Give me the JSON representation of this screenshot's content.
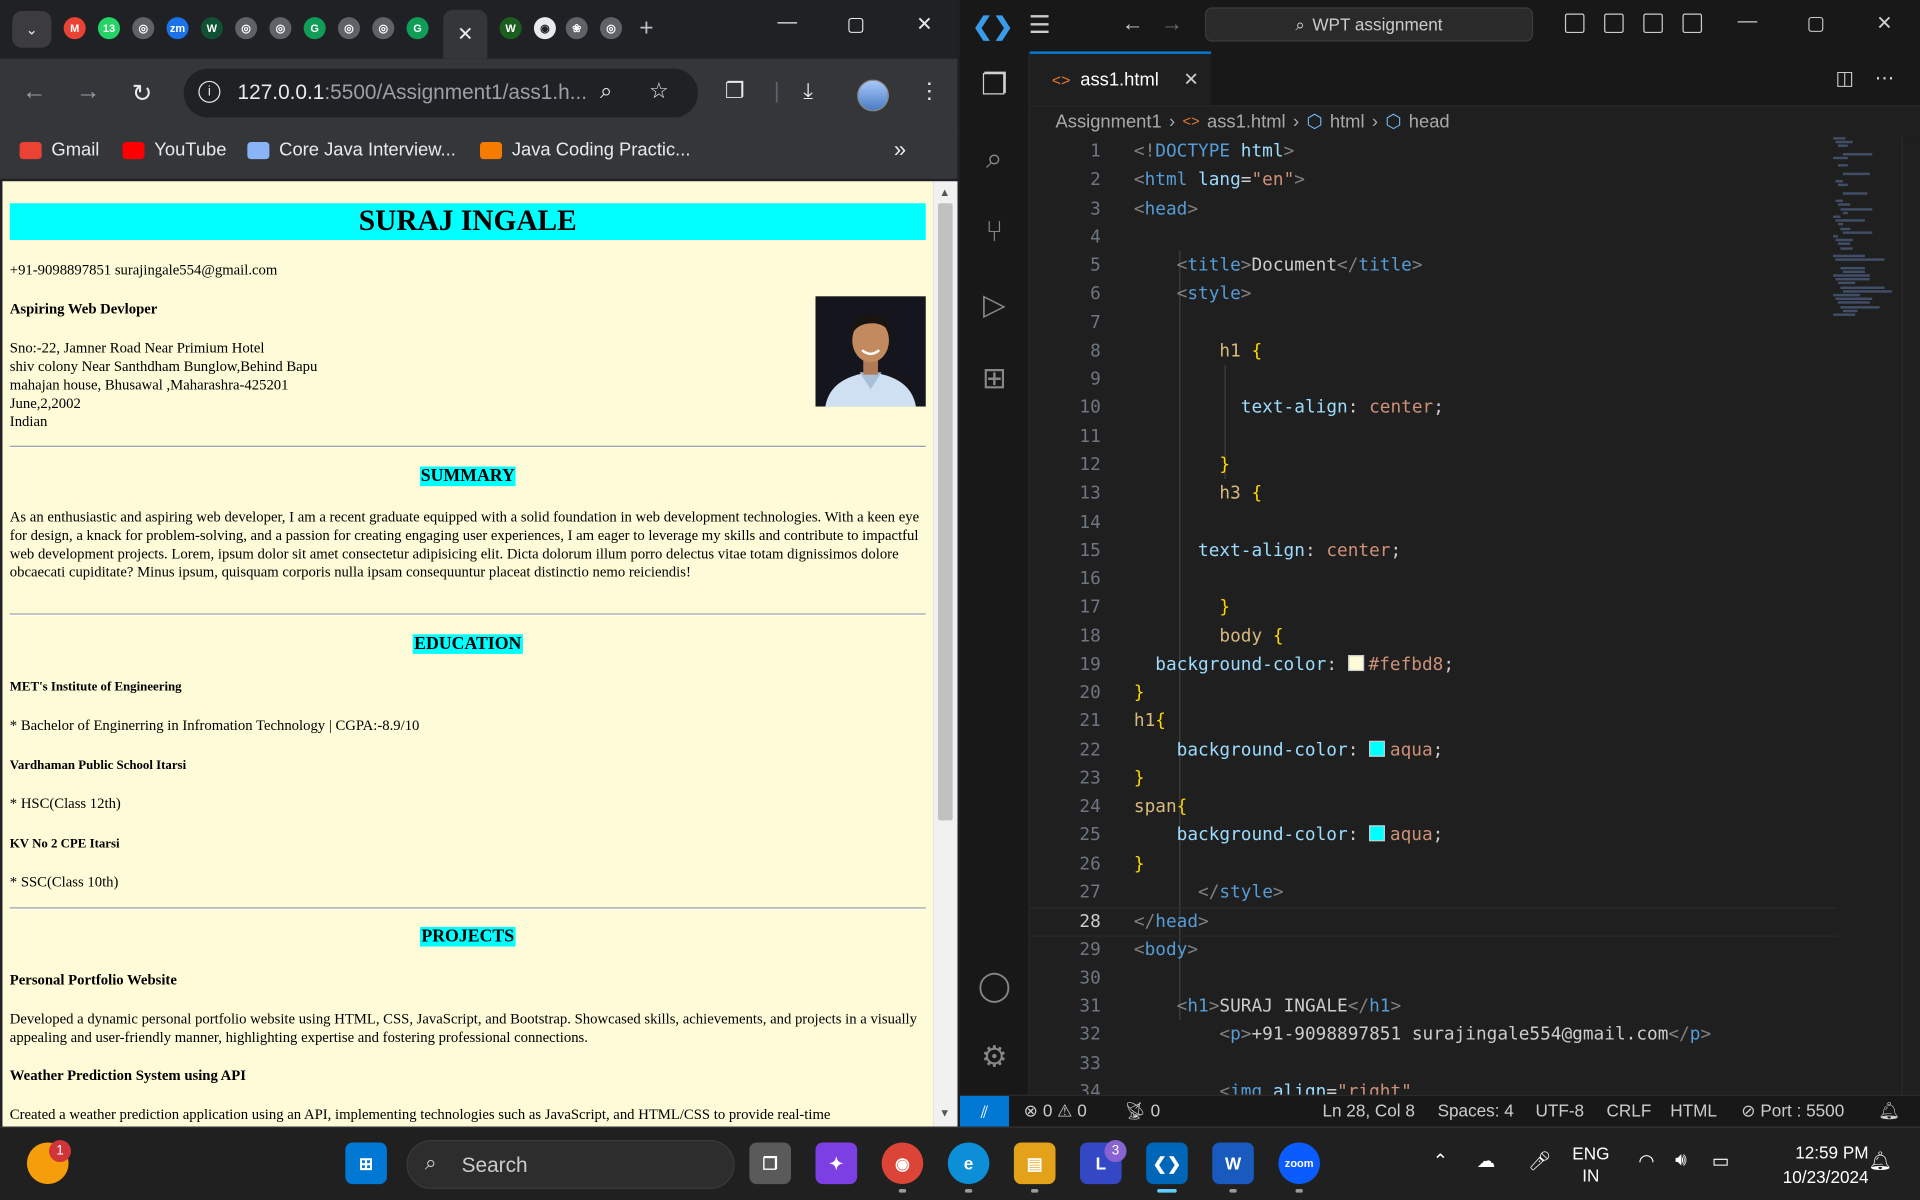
{
  "browser": {
    "url_host": "127.0.0.1",
    "url_rest": ":5500/Assignment1/ass1.h...",
    "pinned_tab_badge": "13",
    "bookmarks": [
      {
        "label": "Gmail",
        "icon": "gmail-icon",
        "color": "#ea4335"
      },
      {
        "label": "YouTube",
        "icon": "youtube-icon",
        "color": "#ff0000"
      },
      {
        "label": "Core Java Interview...",
        "icon": "mountain-icon",
        "color": "#8ab4f8"
      },
      {
        "label": "Java Coding Practic...",
        "icon": "flame-icon",
        "color": "#f57c00"
      }
    ]
  },
  "resume": {
    "name": "SURAJ INGALE",
    "contact": "+91-9098897851 surajingale554@gmail.com",
    "role": "Aspiring Web Devloper",
    "address_lines": [
      "Sno:-22, Jamner Road Near Primium Hotel",
      "shiv colony Near Santhdham Bunglow,Behind Bapu",
      "mahajan house, Bhusawal ,Maharashra-425201",
      "June,2,2002",
      "Indian"
    ],
    "summary_heading": "SUMMARY",
    "summary_text": "As an enthusiastic and aspiring web developer, I am a recent graduate equipped with a solid foundation in web development technologies. With a keen eye for design, a knack for problem-solving, and a passion for creating engaging user experiences, I am eager to leverage my skills and contribute to impactful web development projects. Lorem, ipsum dolor sit amet consectetur adipisicing elit. Dicta dolorum illum porro delectus vitae totam dignissimos dolore obcaecati cupiditate? Minus ipsum, quisquam corporis nulla ipsam consequuntur placeat distinctio nemo reiciendis!",
    "education_heading": "EDUCATION",
    "education": [
      {
        "school": "MET's Institute of Engineering",
        "detail": "* Bachelor of Enginerring in Infromation Technology | CGPA:-8.9/10"
      },
      {
        "school": "Vardhaman Public School Itarsi",
        "detail": "* HSC(Class 12th)"
      },
      {
        "school": "KV No 2 CPE Itarsi",
        "detail": "* SSC(Class 10th)"
      }
    ],
    "projects_heading": "PROJECTS",
    "projects": [
      {
        "title": "Personal Portfolio Website",
        "desc": "Developed a dynamic personal portfolio website using HTML, CSS, JavaScript, and Bootstrap. Showcased skills, achievements, and projects in a visually appealing and user-friendly manner, highlighting expertise and fostering professional connections."
      },
      {
        "title": "Weather Prediction System using API",
        "desc": "Created a weather prediction application using an API, implementing technologies such as JavaScript, and HTML/CSS to provide real-time"
      }
    ]
  },
  "vscode": {
    "command_center": "WPT assignment",
    "tab_label": "ass1.html",
    "breadcrumbs": [
      "Assignment1",
      "ass1.html",
      "html",
      "head"
    ],
    "code_lines": [
      {
        "n": "1",
        "tokens": [
          [
            "pun",
            "<!"
          ],
          [
            "tag",
            "DOCTYPE"
          ],
          [
            "txtc",
            " "
          ],
          [
            "att",
            "html"
          ],
          [
            "pun",
            ">"
          ]
        ]
      },
      {
        "n": "2",
        "tokens": [
          [
            "pun",
            "<"
          ],
          [
            "tag",
            "html"
          ],
          [
            "txtc",
            " "
          ],
          [
            "att",
            "lang"
          ],
          [
            "txtc",
            "="
          ],
          [
            "str",
            "\"en\""
          ],
          [
            "pun",
            ">"
          ]
        ]
      },
      {
        "n": "3",
        "tokens": [
          [
            "pun",
            "<"
          ],
          [
            "tag",
            "head"
          ],
          [
            "pun",
            ">"
          ]
        ]
      },
      {
        "n": "4",
        "tokens": []
      },
      {
        "n": "5",
        "tokens": [
          [
            "txtc",
            "    "
          ],
          [
            "pun",
            "<"
          ],
          [
            "tag",
            "title"
          ],
          [
            "pun",
            ">"
          ],
          [
            "txtc",
            "Document"
          ],
          [
            "pun",
            "</"
          ],
          [
            "tag",
            "title"
          ],
          [
            "pun",
            ">"
          ]
        ]
      },
      {
        "n": "6",
        "tokens": [
          [
            "txtc",
            "    "
          ],
          [
            "pun",
            "<"
          ],
          [
            "tag",
            "style"
          ],
          [
            "pun",
            ">"
          ]
        ]
      },
      {
        "n": "7",
        "tokens": []
      },
      {
        "n": "8",
        "tokens": [
          [
            "txtc",
            "        "
          ],
          [
            "sel",
            "h1"
          ],
          [
            "txtc",
            " "
          ],
          [
            "br1",
            "{"
          ]
        ]
      },
      {
        "n": "9",
        "tokens": []
      },
      {
        "n": "10",
        "tokens": [
          [
            "txtc",
            "          "
          ],
          [
            "prop",
            "text-align"
          ],
          [
            "txtc",
            ": "
          ],
          [
            "val",
            "center"
          ],
          [
            "txtc",
            ";"
          ]
        ]
      },
      {
        "n": "11",
        "tokens": []
      },
      {
        "n": "12",
        "tokens": [
          [
            "txtc",
            "        "
          ],
          [
            "br1",
            "}"
          ]
        ]
      },
      {
        "n": "13",
        "tokens": [
          [
            "txtc",
            "        "
          ],
          [
            "sel",
            "h3"
          ],
          [
            "txtc",
            " "
          ],
          [
            "br1",
            "{"
          ]
        ]
      },
      {
        "n": "14",
        "tokens": []
      },
      {
        "n": "15",
        "tokens": [
          [
            "txtc",
            "      "
          ],
          [
            "prop",
            "text-align"
          ],
          [
            "txtc",
            ": "
          ],
          [
            "val",
            "center"
          ],
          [
            "txtc",
            ";"
          ]
        ]
      },
      {
        "n": "16",
        "tokens": []
      },
      {
        "n": "17",
        "tokens": [
          [
            "txtc",
            "        "
          ],
          [
            "br1",
            "}"
          ]
        ]
      },
      {
        "n": "18",
        "tokens": [
          [
            "txtc",
            "        "
          ],
          [
            "sel",
            "body"
          ],
          [
            "txtc",
            " "
          ],
          [
            "br1",
            "{"
          ]
        ]
      },
      {
        "n": "19",
        "tokens": [
          [
            "txtc",
            "  "
          ],
          [
            "prop",
            "background-color"
          ],
          [
            "txtc",
            ": "
          ],
          [
            "swatch",
            "#fefbd8"
          ],
          [
            "val",
            "#fefbd8"
          ],
          [
            "txtc",
            ";"
          ]
        ]
      },
      {
        "n": "20",
        "tokens": [
          [
            "br1",
            "}"
          ]
        ]
      },
      {
        "n": "21",
        "tokens": [
          [
            "sel",
            "h1"
          ],
          [
            "br1",
            "{"
          ]
        ]
      },
      {
        "n": "22",
        "tokens": [
          [
            "txtc",
            "    "
          ],
          [
            "prop",
            "background-color"
          ],
          [
            "txtc",
            ": "
          ],
          [
            "swatch",
            "aqua"
          ],
          [
            "val",
            "aqua"
          ],
          [
            "txtc",
            ";"
          ]
        ]
      },
      {
        "n": "23",
        "tokens": [
          [
            "br1",
            "}"
          ]
        ]
      },
      {
        "n": "24",
        "tokens": [
          [
            "sel",
            "span"
          ],
          [
            "br1",
            "{"
          ]
        ]
      },
      {
        "n": "25",
        "tokens": [
          [
            "txtc",
            "    "
          ],
          [
            "prop",
            "background-color"
          ],
          [
            "txtc",
            ": "
          ],
          [
            "swatch",
            "aqua"
          ],
          [
            "val",
            "aqua"
          ],
          [
            "txtc",
            ";"
          ]
        ]
      },
      {
        "n": "26",
        "tokens": [
          [
            "br1",
            "}"
          ]
        ]
      },
      {
        "n": "27",
        "tokens": [
          [
            "txtc",
            "      "
          ],
          [
            "pun",
            "</"
          ],
          [
            "tag",
            "style"
          ],
          [
            "pun",
            ">"
          ]
        ]
      },
      {
        "n": "28",
        "tokens": [
          [
            "pun",
            "</"
          ],
          [
            "tag",
            "head"
          ],
          [
            "pun",
            ">"
          ]
        ]
      },
      {
        "n": "29",
        "tokens": [
          [
            "pun",
            "<"
          ],
          [
            "tag",
            "body"
          ],
          [
            "pun",
            ">"
          ]
        ]
      },
      {
        "n": "30",
        "tokens": []
      },
      {
        "n": "31",
        "tokens": [
          [
            "txtc",
            "    "
          ],
          [
            "pun",
            "<"
          ],
          [
            "tag",
            "h1"
          ],
          [
            "pun",
            ">"
          ],
          [
            "txtc",
            "SURAJ INGALE"
          ],
          [
            "pun",
            "</"
          ],
          [
            "tag",
            "h1"
          ],
          [
            "pun",
            ">"
          ]
        ]
      },
      {
        "n": "32",
        "tokens": [
          [
            "txtc",
            "        "
          ],
          [
            "pun",
            "<"
          ],
          [
            "tag",
            "p"
          ],
          [
            "pun",
            ">"
          ],
          [
            "txtc",
            "+91-9098897851 surajingale554@gmail.com"
          ],
          [
            "pun",
            "</"
          ],
          [
            "tag",
            "p"
          ],
          [
            "pun",
            ">"
          ]
        ]
      },
      {
        "n": "33",
        "tokens": []
      },
      {
        "n": "34",
        "tokens": [
          [
            "txtc",
            "        "
          ],
          [
            "pun",
            "<"
          ],
          [
            "tag",
            "img"
          ],
          [
            "txtc",
            " "
          ],
          [
            "att",
            "align"
          ],
          [
            "txtc",
            "="
          ],
          [
            "str",
            "\"right\""
          ]
        ]
      }
    ],
    "current_line": "28",
    "status": {
      "errors": "0",
      "warnings": "0",
      "ports": "0",
      "position": "Ln 28, Col 8",
      "spaces": "Spaces: 4",
      "encoding": "UTF-8",
      "eol": "CRLF",
      "language": "HTML",
      "port": "Port : 5500"
    }
  },
  "taskbar": {
    "search_placeholder": "Search",
    "lang_top": "ENG",
    "lang_bottom": "IN",
    "time": "12:59 PM",
    "date": "10/23/2024",
    "left_badge": "1",
    "linkedin_badge": "3"
  }
}
